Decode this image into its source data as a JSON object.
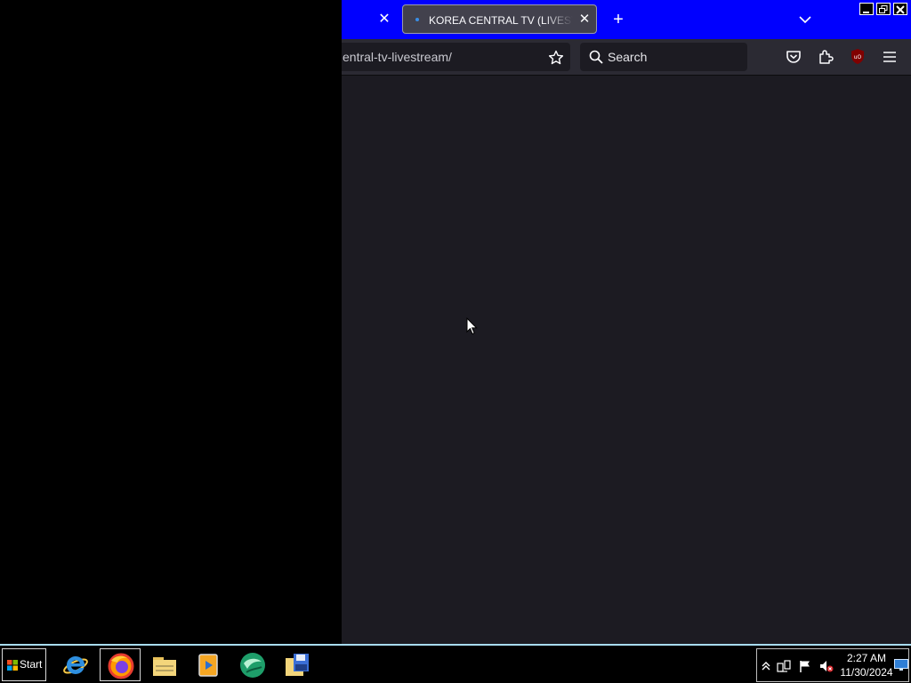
{
  "browser": {
    "tabs": [
      {
        "title": "KOREA CENTRAL TV (LIVESTREAM)",
        "active": true
      }
    ],
    "url": "entral-tv-livestream/",
    "search": {
      "placeholder": "Search"
    },
    "colors": {
      "titlebar": "#0000ff",
      "toolbar": "#2b2a33",
      "content": "#1c1b22",
      "tab_active": "#42414d"
    }
  },
  "icons": {
    "tab_close": "close-icon",
    "new_tab": "plus-icon",
    "tab_list": "chevron-down-icon",
    "bookmark": "star-icon",
    "search": "search-icon",
    "pocket": "pocket-icon",
    "extensions": "puzzle-icon",
    "ublock": "ublock-origin-icon",
    "menu": "hamburger-menu-icon"
  },
  "taskbar": {
    "start_label": "Start",
    "pinned_apps": [
      "internet-explorer",
      "firefox",
      "file-explorer",
      "media-player",
      "green-app",
      "backup-save"
    ],
    "clock": {
      "time": "2:27 AM",
      "date": "11/30/2024"
    },
    "colors": {
      "border": "#a8dcf0"
    }
  }
}
